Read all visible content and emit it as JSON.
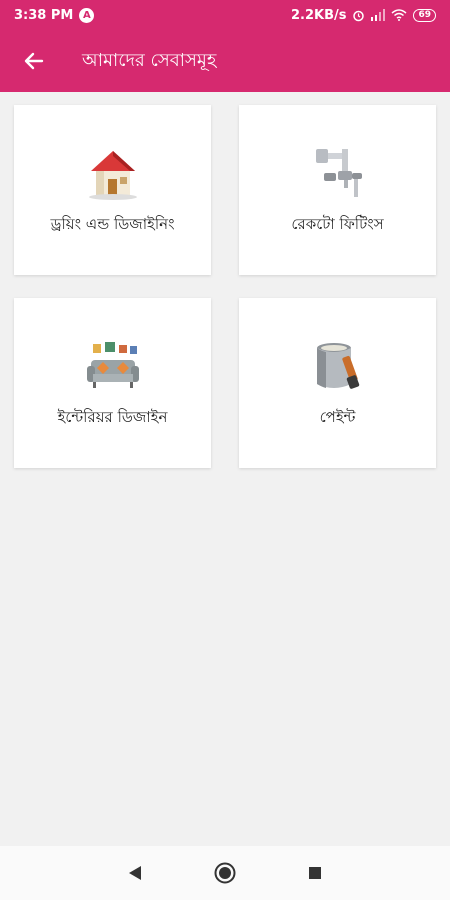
{
  "status_bar": {
    "time": "3:38 PM",
    "notification_icon": "A",
    "speed": "2.2KB/s",
    "battery": "69"
  },
  "app_bar": {
    "title": "আমাদের সেবাসমূহ",
    "back_icon": "arrow-left-icon"
  },
  "services": [
    {
      "label": "ড্রয়িং এন্ড ডিজাইনিং",
      "icon": "house-icon"
    },
    {
      "label": "রেকটো ফিটিংস",
      "icon": "faucet-icon"
    },
    {
      "label": "ইন্টেরিয়র ডিজাইন",
      "icon": "sofa-icon"
    },
    {
      "label": "পেইন্ট",
      "icon": "paint-bucket-icon"
    }
  ],
  "colors": {
    "primary": "#d6296f",
    "background": "#f1f1f1"
  },
  "nav_bar": {
    "icons": [
      "back-triangle-icon",
      "home-circle-icon",
      "recents-square-icon"
    ]
  }
}
